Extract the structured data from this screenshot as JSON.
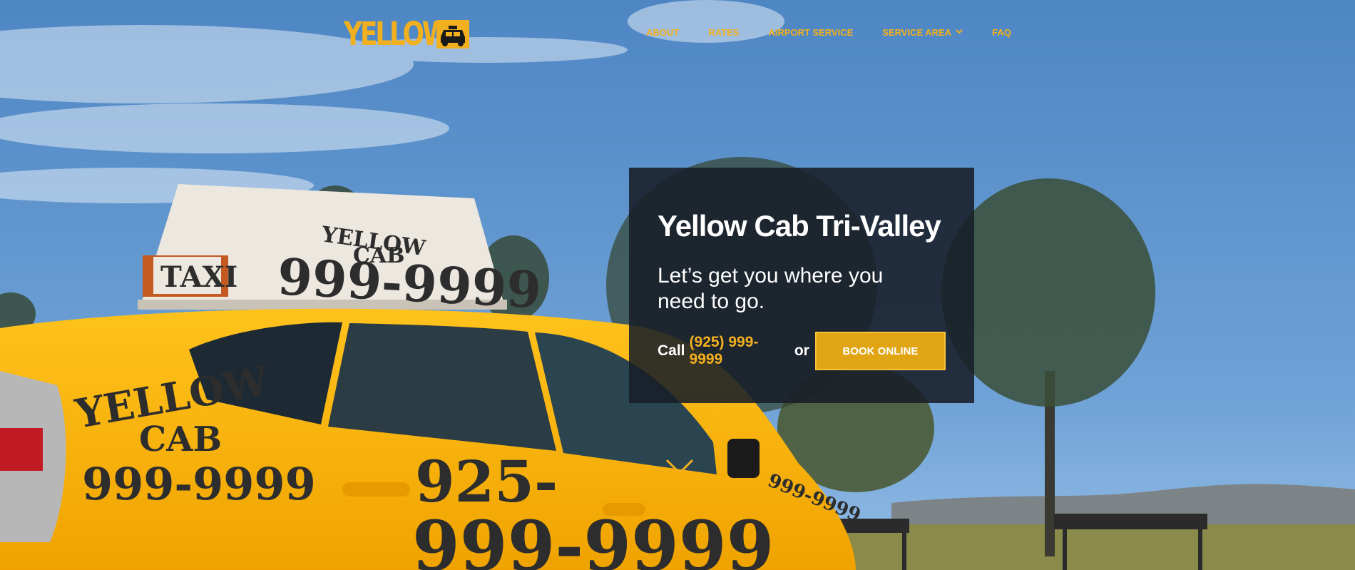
{
  "logo": {
    "text": "YELLOW"
  },
  "nav": {
    "items": [
      {
        "label": "ABOUT"
      },
      {
        "label": "RATES"
      },
      {
        "label": "AIRPORT SERVICE"
      },
      {
        "label": "SERVICE AREA"
      },
      {
        "label": "FAQ"
      }
    ]
  },
  "hero": {
    "title": "Yellow Cab Tri-Valley",
    "tagline": "Let’s get you where you need to go.",
    "call_prefix": "Call",
    "phone": "(925) 999-9999",
    "call_suffix": "or",
    "book_label": "BOOK ONLINE"
  },
  "taxi": {
    "sign_line1": "YELLOW",
    "sign_line2": "CAB",
    "sign_phone": "999-9999",
    "sign_taxi": "TAXI",
    "door_line1": "YELLOW",
    "door_line2": "CAB",
    "door_phone": "999-9999",
    "door_925": "925-",
    "door_big": "999-9999",
    "fender": "999-9999"
  },
  "colors": {
    "accent": "#f2b01e",
    "sky": "#4f88c8",
    "card": "#181e28",
    "button": "#e1a514"
  },
  "icons": {
    "logo_cab": "taxi-icon",
    "nav_dropdown": "chevron-down-icon",
    "scroll": "chevron-down-icon"
  }
}
